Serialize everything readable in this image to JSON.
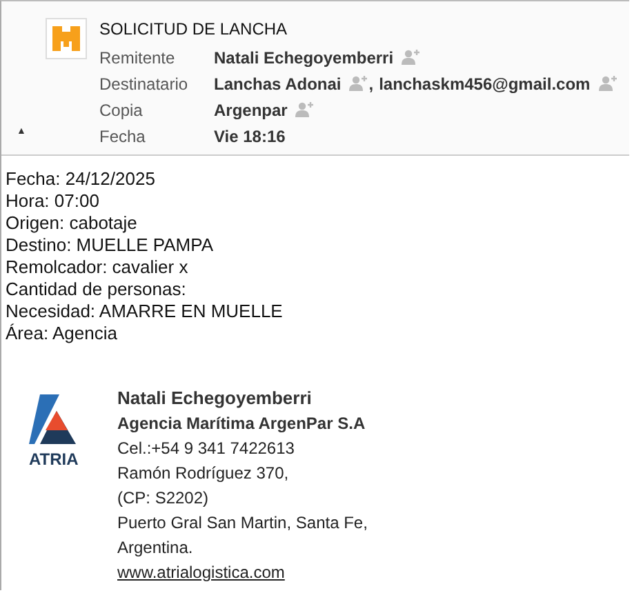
{
  "header": {
    "subject": "SOLICITUD DE LANCHA",
    "collapse_glyph": "▲",
    "fields": [
      {
        "label": "Remitente",
        "people": [
          {
            "name": "Natali Echegoyemberri"
          }
        ]
      },
      {
        "label": "Destinatario",
        "people": [
          {
            "name": "Lanchas Adonai",
            "suffix": ","
          },
          {
            "name": "lanchaskm456@gmail.com"
          }
        ]
      },
      {
        "label": "Copia",
        "people": [
          {
            "name": "Argenpar"
          }
        ]
      },
      {
        "label": "Fecha",
        "value": "Vie 18:16"
      }
    ]
  },
  "body": {
    "lines": [
      "Fecha: 24/12/2025",
      "Hora: 07:00",
      "Origen: cabotaje",
      "Destino: MUELLE PAMPA",
      "Remolcador: cavalier x",
      "Cantidad de personas:",
      "Necesidad: AMARRE EN MUELLE",
      "Área: Agencia"
    ]
  },
  "signature": {
    "logo_text": "ATRIA",
    "name": "Natali Echegoyemberri",
    "company": "Agencia Marítima ArgenPar S.A",
    "lines": [
      "Cel.:+54 9 341 7422613",
      "Ramón Rodríguez 370,",
      "(CP: S2202)",
      "Puerto Gral San Martin, Santa Fe,",
      "Argentina."
    ],
    "link": "www.atrialogistica.com"
  }
}
